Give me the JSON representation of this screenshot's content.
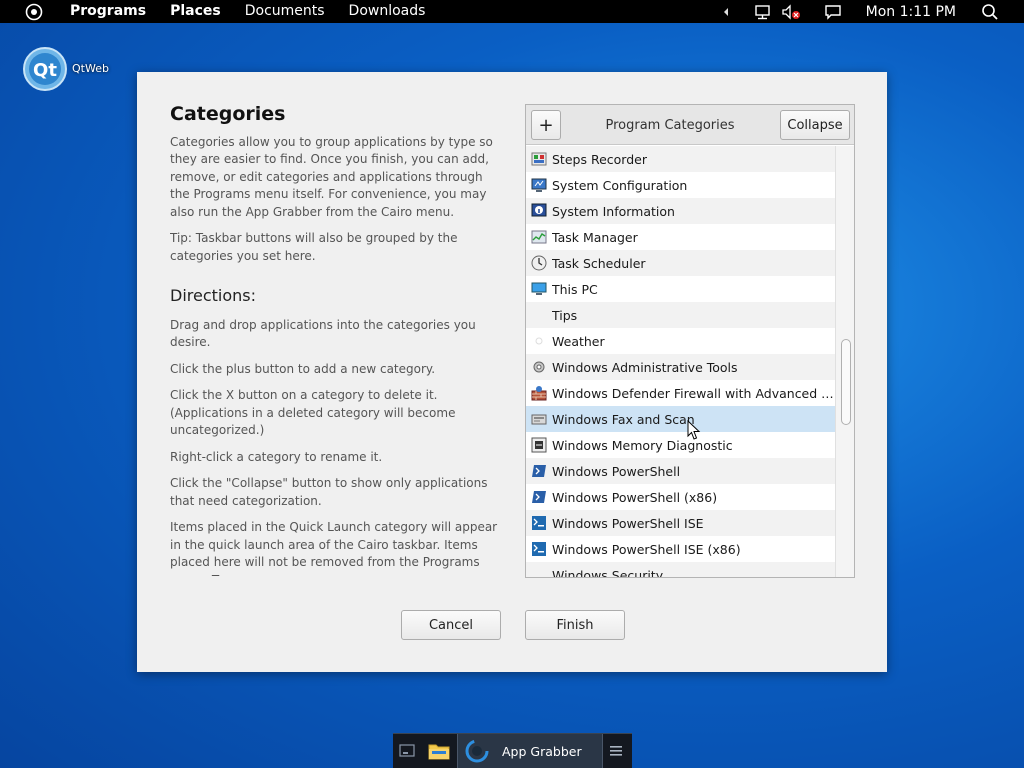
{
  "menubar": {
    "items": [
      "Programs",
      "Places",
      "Documents",
      "Downloads"
    ],
    "clock": "Mon 1:11 PM",
    "icons": [
      "cairo-menu-icon",
      "tray-expand-icon",
      "network-icon",
      "volume-muted-icon",
      "action-center-icon",
      "search-icon"
    ]
  },
  "desktop": {
    "icon_label": "QtWeb"
  },
  "dialog": {
    "heading": "Categories",
    "intro": "Categories allow you to group applications by type so they are easier to find. Once you finish, you can add, remove, or edit categories and applications through the Programs menu itself. For convenience, you may also run the App Grabber from the Cairo menu.",
    "tip": "Tip: Taskbar buttons will also be grouped by the categories you set here.",
    "directions_heading": "Directions:",
    "directions": [
      "Drag and drop applications into the categories you desire.",
      "Click the plus button to add a new category.",
      "Click the X button on a category to delete it. (Applications in a deleted category will become uncategorized.)",
      "Right-click a category to rename it.",
      "Click the \"Collapse\" button to show only applications that need categorization.",
      "Items placed in the Quick Launch category will appear in the quick launch area of the Cairo taskbar. Items placed here will not be removed from the Programs menu.  To"
    ],
    "panel": {
      "plus_label": "+",
      "title": "Program Categories",
      "collapse_label": "Collapse",
      "items": [
        {
          "label": "Steps Recorder",
          "icon": "steps-recorder-icon",
          "selected": false
        },
        {
          "label": "System Configuration",
          "icon": "system-configuration-icon",
          "selected": false
        },
        {
          "label": "System Information",
          "icon": "system-information-icon",
          "selected": false
        },
        {
          "label": "Task Manager",
          "icon": "task-manager-icon",
          "selected": false
        },
        {
          "label": "Task Scheduler",
          "icon": "task-scheduler-icon",
          "selected": false
        },
        {
          "label": "This PC",
          "icon": "this-pc-icon",
          "selected": false
        },
        {
          "label": "Tips",
          "icon": "",
          "selected": false
        },
        {
          "label": "Weather",
          "icon": "weather-icon",
          "selected": false
        },
        {
          "label": "Windows Administrative Tools",
          "icon": "administrative-tools-icon",
          "selected": false
        },
        {
          "label": "Windows Defender Firewall with Advanced Se...",
          "icon": "firewall-icon",
          "selected": false
        },
        {
          "label": "Windows Fax and Scan",
          "icon": "fax-scan-icon",
          "selected": true
        },
        {
          "label": "Windows Memory Diagnostic",
          "icon": "memory-diagnostic-icon",
          "selected": false
        },
        {
          "label": "Windows PowerShell",
          "icon": "powershell-icon",
          "selected": false
        },
        {
          "label": "Windows PowerShell (x86)",
          "icon": "powershell-icon",
          "selected": false
        },
        {
          "label": "Windows PowerShell ISE",
          "icon": "powershell-ise-icon",
          "selected": false
        },
        {
          "label": "Windows PowerShell ISE (x86)",
          "icon": "powershell-ise-icon",
          "selected": false
        },
        {
          "label": "Windows Security",
          "icon": "",
          "selected": false
        }
      ],
      "scroll_position": 0.45
    },
    "cancel_label": "Cancel",
    "finish_label": "Finish"
  },
  "taskbar": {
    "app_label": "App Grabber",
    "icons": [
      "desktop-icon",
      "file-explorer-icon",
      "app-grabber-icon",
      "taskbar-menu-icon"
    ]
  },
  "colors": {
    "selection": "#cde3f5",
    "desktop": "#0a5fc4",
    "menubar": "#000000"
  }
}
